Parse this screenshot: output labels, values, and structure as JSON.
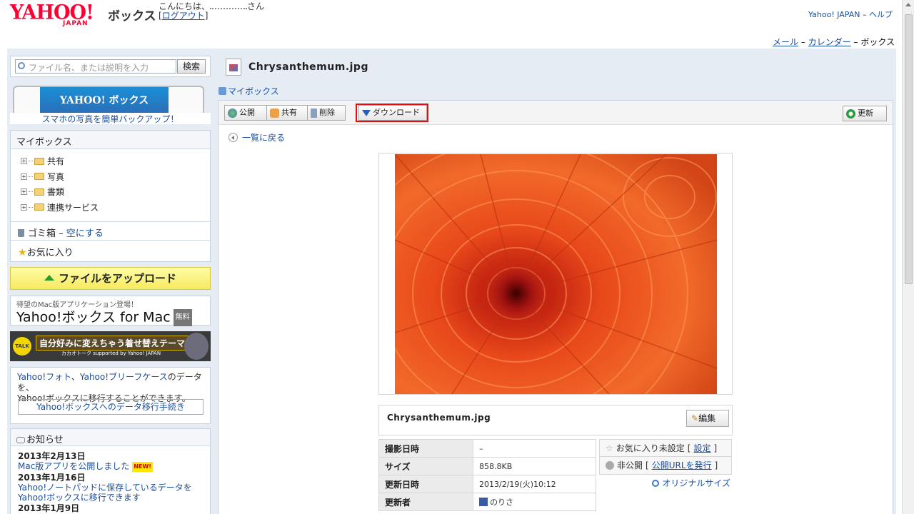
{
  "header": {
    "logo_text": "YAHOO!",
    "logo_sub": "JAPAN",
    "service_name": "ボックス",
    "greeting": "こんにちは、",
    "greeting_suffix": "さん",
    "logout": "ログアウト",
    "top_link_yahoo": "Yahoo! JAPAN",
    "top_link_help": "ヘルプ",
    "sep": " – ",
    "nav_mail": "メール",
    "nav_calendar": "カレンダー",
    "nav_box": "ボックス"
  },
  "sidebar": {
    "search_placeholder": "ファイル名、または説明を入力",
    "search_button": "検索",
    "promo_screen": "YAHOO! ボックス",
    "promo_caption": "スマホの写真を簡単バックアップ！",
    "mybox_title": "マイボックス",
    "tree": [
      {
        "label": "共有"
      },
      {
        "label": "写真"
      },
      {
        "label": "書類"
      },
      {
        "label": "連携サービス"
      }
    ],
    "trash_label": "ゴミ箱",
    "trash_empty": "空にする",
    "favorites": "お気に入り",
    "upload": "ファイルをアップロード",
    "mac_small": "待望のMac版アプリケーション登場！",
    "mac_big": "Yahoo!ボックス for Mac",
    "mac_free": "無料",
    "kakao_main": "自分好みに変えちゃう着せ替えテーマ",
    "kakao_sub": "カカオトーク supported by Yahoo! JAPAN",
    "kakao_talk": "TALK",
    "migrate_l1a": "Yahoo!フォト",
    "migrate_l1b": "、",
    "migrate_l1c": "Yahoo!ブリーフケース",
    "migrate_l1d": "のデータを、",
    "migrate_l2": "Yahoo!ボックスに移行することができます。",
    "migrate_button": "Yahoo!ボックスへのデータ移行手続き",
    "news_title": "お知らせ",
    "news": [
      {
        "date": "2013年2月13日",
        "text": "Mac版アプリを公開しました",
        "badge": "NEW!"
      },
      {
        "date": "2013年1月16日",
        "text": "Yahoo!ノートパッドに保存しているデータをYahoo!ボックスに移行できます"
      },
      {
        "date": "2013年1月9日",
        "text": ""
      }
    ]
  },
  "main": {
    "file_title": "Chrysanthemum.jpg",
    "breadcrumb": "マイボックス",
    "toolbar": {
      "public": "公開",
      "share": "共有",
      "delete": "削除",
      "download": "ダウンロード",
      "refresh": "更新"
    },
    "back": "一覧に戻る",
    "image_name": "Chrysanthemum.jpg",
    "edit": "編集",
    "meta": [
      {
        "key": "撮影日時",
        "value": "–"
      },
      {
        "key": "サイズ",
        "value": "858.8KB"
      },
      {
        "key": "更新日時",
        "value": "2013/2/19(火)10:12"
      },
      {
        "key": "更新者",
        "value": "のりさ"
      }
    ],
    "fav_status": "お気に入り未設定",
    "fav_set": "設定",
    "public_status": "非公開",
    "public_url": "公開URLを発行",
    "original_size": "オリジナルサイズ"
  },
  "colors": {
    "brand_red": "#ff0033",
    "link_blue": "#1a4fa0",
    "highlight_red": "#e01010",
    "upload_yellow": "#f5ea60"
  }
}
